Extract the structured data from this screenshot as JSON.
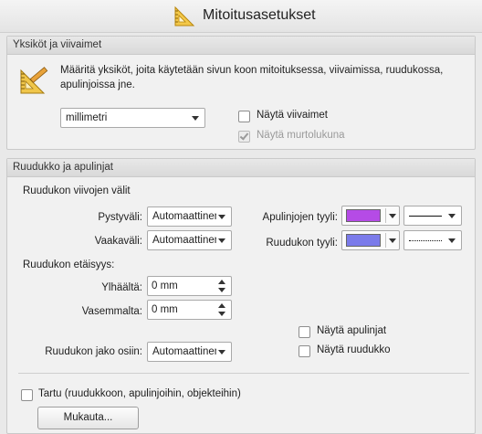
{
  "window": {
    "title": "Mitoitusasetukset",
    "icon": "ruler-triangle-icon"
  },
  "units_section": {
    "header": "Yksiköt ja viivaimet",
    "description": "Määritä yksiköt, joita käytetään sivun koon mitoituksessa, viivaimissa, ruudukossa, apulinjoissa jne.",
    "unit_select": {
      "value": "millimetri"
    },
    "show_rulers": {
      "label": "Näytä viivaimet",
      "checked": false
    },
    "show_as_fraction": {
      "label": "Näytä murtolukuna",
      "checked": true,
      "disabled": true
    }
  },
  "grid_section": {
    "header": "Ruudukko ja apulinjat",
    "line_spacing_title": "Ruudukon viivojen välit",
    "vertical": {
      "label": "Pystyväli:",
      "value": "Automaattinen"
    },
    "horizontal": {
      "label": "Vaakaväli:",
      "value": "Automaattinen"
    },
    "guide_style": {
      "label": "Apulinjojen tyyli:",
      "color": "#b54be6",
      "line": "solid"
    },
    "grid_style": {
      "label": "Ruudukon tyyli:",
      "color": "#7b7bea",
      "line": "dotted"
    },
    "offset_title": "Ruudukon etäisyys:",
    "from_top": {
      "label": "Ylhäältä:",
      "value": "0 mm"
    },
    "from_left": {
      "label": "Vasemmalta:",
      "value": "0 mm"
    },
    "show_guides": {
      "label": "Näytä apulinjat",
      "checked": false
    },
    "show_grid": {
      "label": "Näytä ruudukko",
      "checked": false
    },
    "subdivisions": {
      "label": "Ruudukon jako osiin:",
      "value": "Automaattinen"
    },
    "snap": {
      "label": "Tartu (ruudukkoon, apulinjoihin, objekteihin)",
      "checked": false
    },
    "customize_button": "Mukauta..."
  }
}
